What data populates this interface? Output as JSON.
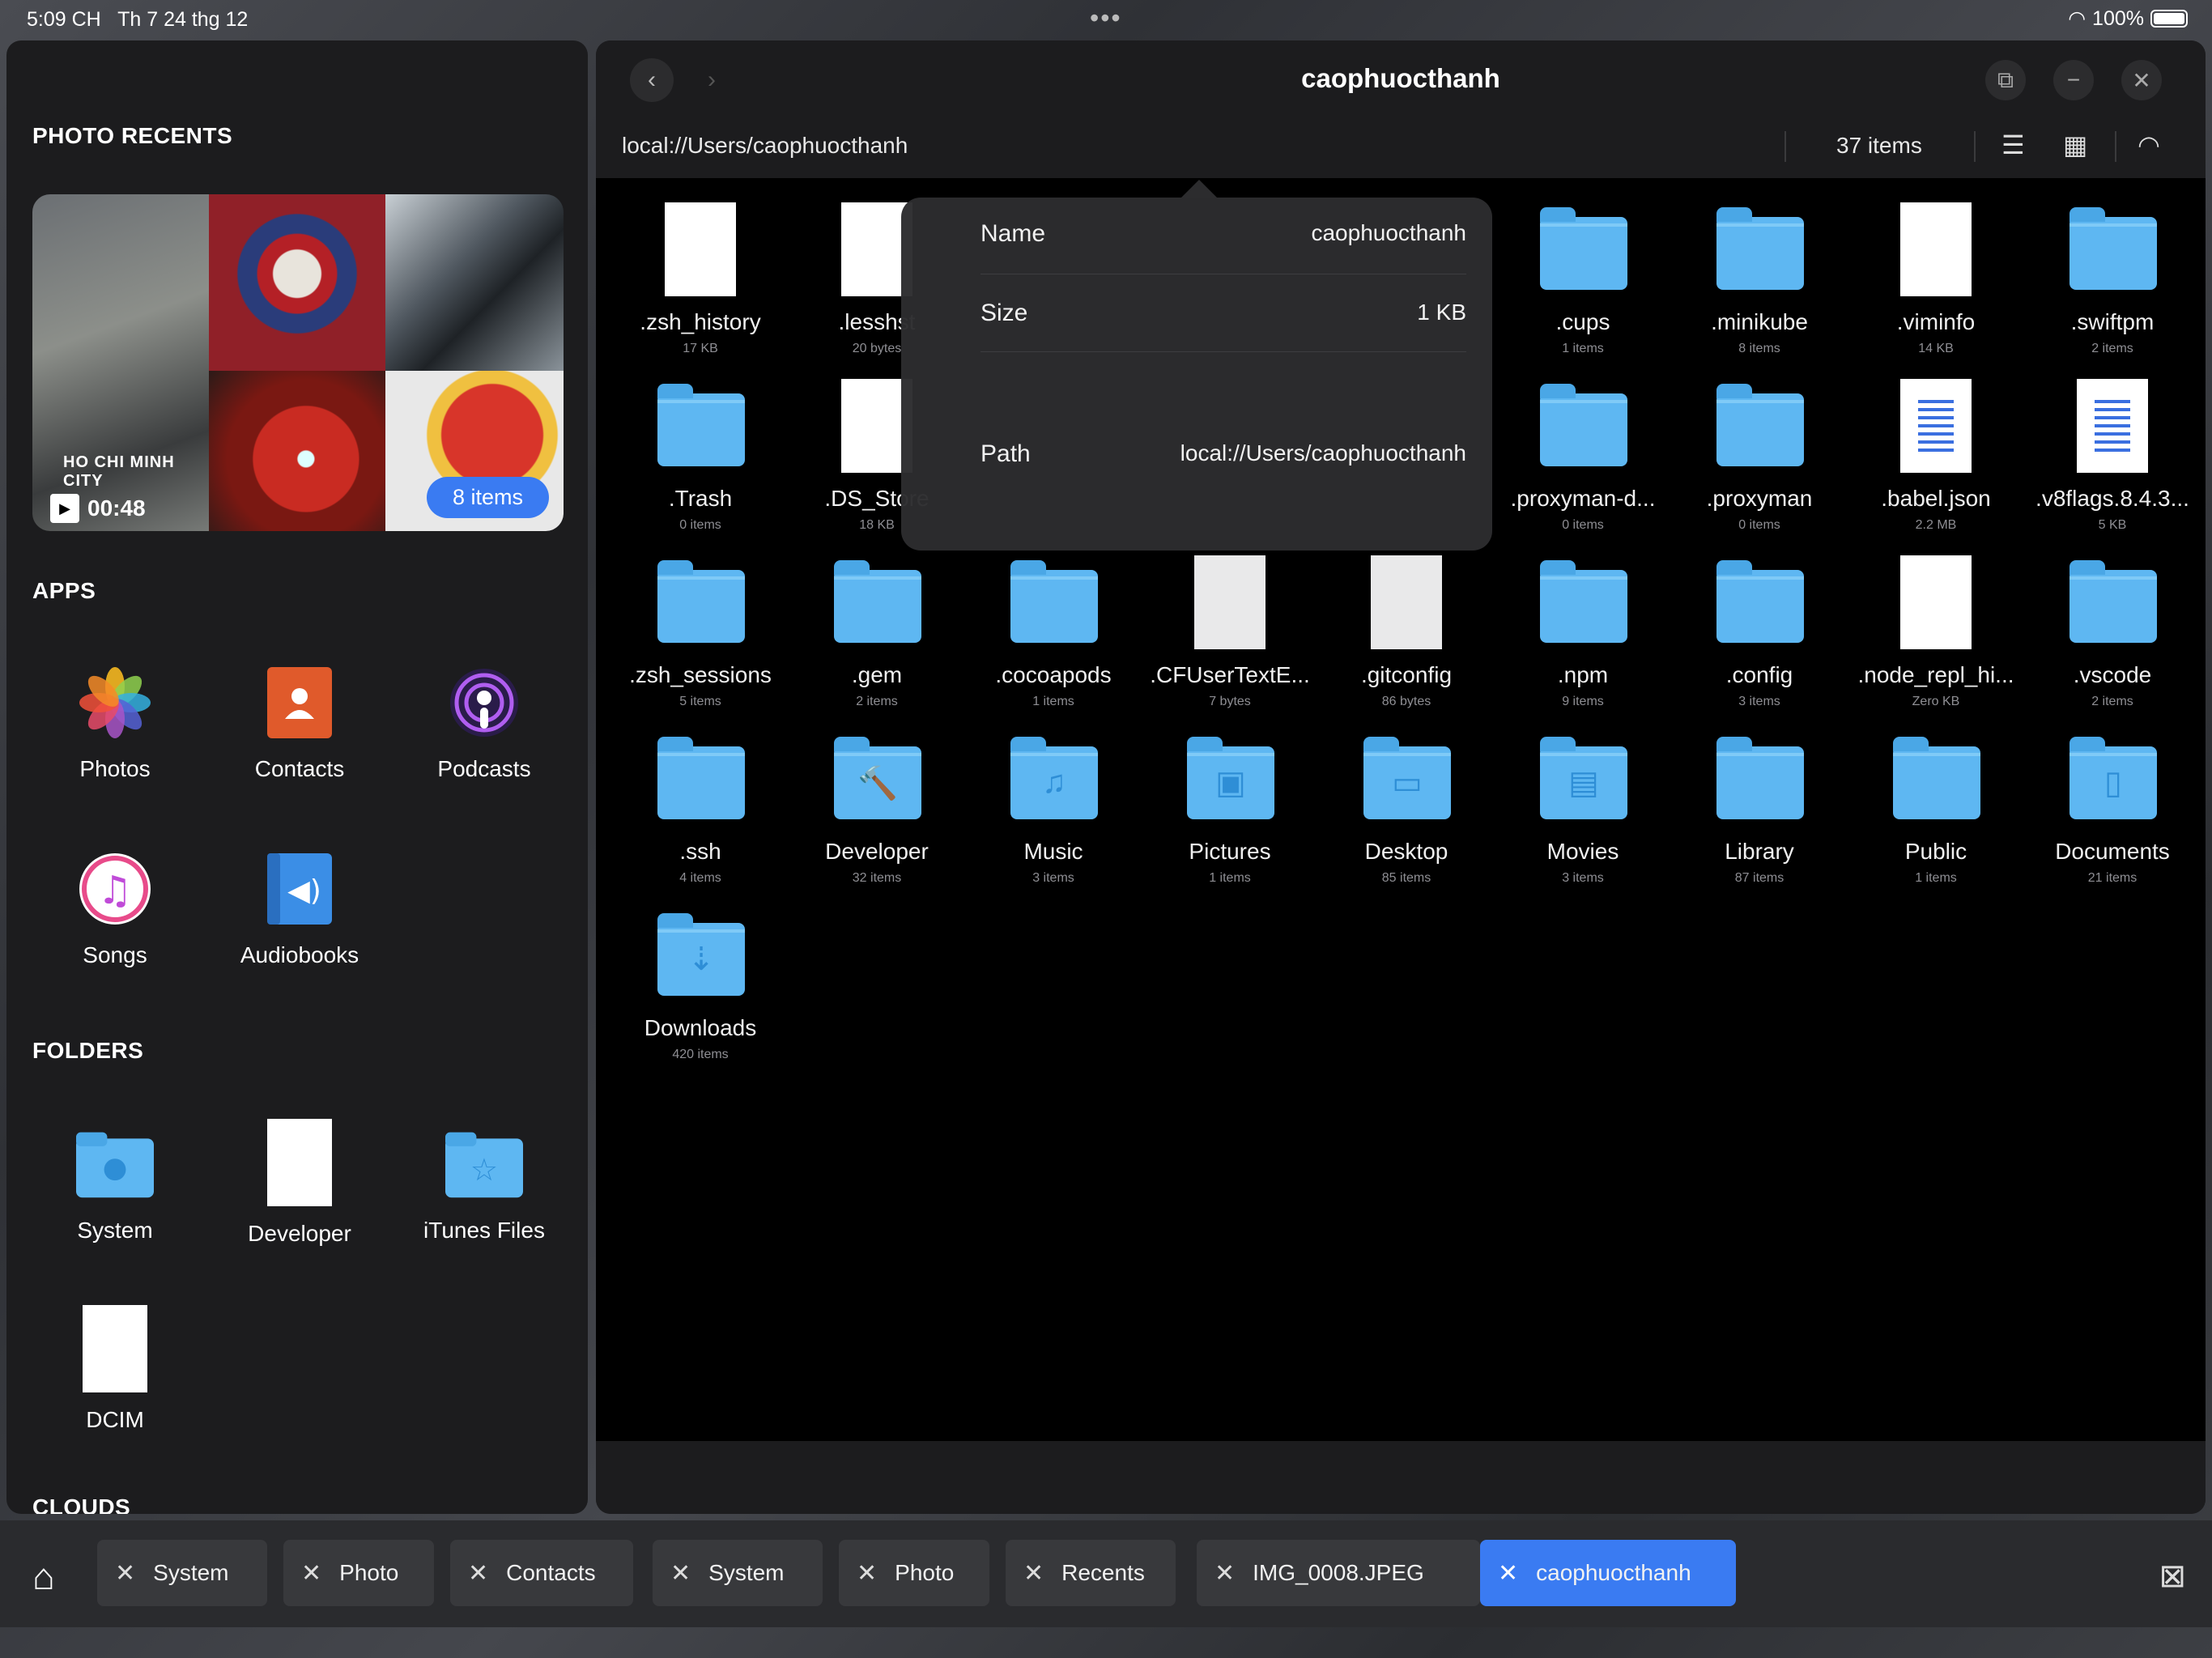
{
  "status": {
    "time": "5:09 CH",
    "date": "Th 7 24 thg 12",
    "battery": "100%"
  },
  "sidebar": {
    "photo_recents_title": "PHOTO RECENTS",
    "video_duration": "00:48",
    "video_caption": "HO CHI MINH CITY",
    "items_pill": "8 items",
    "apps_title": "APPS",
    "apps": [
      {
        "label": "Photos",
        "icon": "photos-icon"
      },
      {
        "label": "Contacts",
        "icon": "contacts-icon"
      },
      {
        "label": "Podcasts",
        "icon": "podcasts-icon"
      },
      {
        "label": "Songs",
        "icon": "songs-icon"
      },
      {
        "label": "Audiobooks",
        "icon": "audiobooks-icon"
      }
    ],
    "folders_title": "FOLDERS",
    "folders": [
      {
        "label": "System",
        "icon": "system-folder-icon"
      },
      {
        "label": "Developer",
        "icon": "document-icon"
      },
      {
        "label": "iTunes Files",
        "icon": "star-folder-icon"
      },
      {
        "label": "DCIM",
        "icon": "document-icon"
      }
    ],
    "clouds_title": "CLOUDS"
  },
  "window": {
    "title": "caophuocthanh",
    "path": "local://Users/caophuocthanh",
    "item_count": "37 items"
  },
  "files": [
    {
      "name": ".zsh_history",
      "meta": "17 KB",
      "kind": "doc"
    },
    {
      "name": ".lesshst",
      "meta": "20 bytes",
      "kind": "doc"
    },
    {
      "name": "",
      "meta": "",
      "kind": "hidden"
    },
    {
      "name": "",
      "meta": "",
      "kind": "hidden"
    },
    {
      "name": "",
      "meta": "",
      "kind": "hidden"
    },
    {
      "name": ".cups",
      "meta": "1 items",
      "kind": "folder"
    },
    {
      "name": ".minikube",
      "meta": "8 items",
      "kind": "folder"
    },
    {
      "name": ".viminfo",
      "meta": "14 KB",
      "kind": "doc"
    },
    {
      "name": ".swiftpm",
      "meta": "2 items",
      "kind": "folder"
    },
    {
      "name": ".Trash",
      "meta": "0 items",
      "kind": "folder"
    },
    {
      "name": ".DS_Store",
      "meta": "18 KB",
      "kind": "doc"
    },
    {
      "name": "",
      "meta": "",
      "kind": "hidden"
    },
    {
      "name": "",
      "meta": "",
      "kind": "hidden"
    },
    {
      "name": "",
      "meta": "",
      "kind": "hidden"
    },
    {
      "name": ".proxyman-d...",
      "meta": "0 items",
      "kind": "folder"
    },
    {
      "name": ".proxyman",
      "meta": "0 items",
      "kind": "folder"
    },
    {
      "name": ".babel.json",
      "meta": "2.2 MB",
      "kind": "txt"
    },
    {
      "name": ".v8flags.8.4.3...",
      "meta": "5 KB",
      "kind": "txt"
    },
    {
      "name": ".zsh_sessions",
      "meta": "5 items",
      "kind": "folder"
    },
    {
      "name": ".gem",
      "meta": "2 items",
      "kind": "folder"
    },
    {
      "name": ".cocoapods",
      "meta": "1 items",
      "kind": "folder"
    },
    {
      "name": ".CFUserTextE...",
      "meta": "7 bytes",
      "kind": "grey"
    },
    {
      "name": ".gitconfig",
      "meta": "86 bytes",
      "kind": "grey"
    },
    {
      "name": ".npm",
      "meta": "9 items",
      "kind": "folder"
    },
    {
      "name": ".config",
      "meta": "3 items",
      "kind": "folder"
    },
    {
      "name": ".node_repl_hi...",
      "meta": "Zero KB",
      "kind": "doc"
    },
    {
      "name": ".vscode",
      "meta": "2 items",
      "kind": "folder"
    },
    {
      "name": ".ssh",
      "meta": "4 items",
      "kind": "folder"
    },
    {
      "name": "Developer",
      "meta": "32 items",
      "kind": "folder",
      "glyph": "🔨"
    },
    {
      "name": "Music",
      "meta": "3 items",
      "kind": "folder",
      "glyph": "♫"
    },
    {
      "name": "Pictures",
      "meta": "1 items",
      "kind": "folder",
      "glyph": "▣"
    },
    {
      "name": "Desktop",
      "meta": "85 items",
      "kind": "folder",
      "glyph": "▭"
    },
    {
      "name": "Movies",
      "meta": "3 items",
      "kind": "folder",
      "glyph": "▤"
    },
    {
      "name": "Library",
      "meta": "87 items",
      "kind": "folder"
    },
    {
      "name": "Public",
      "meta": "1 items",
      "kind": "folder"
    },
    {
      "name": "Documents",
      "meta": "21 items",
      "kind": "folder",
      "glyph": "▯"
    },
    {
      "name": "Downloads",
      "meta": "420 items",
      "kind": "folder",
      "glyph": "⇣"
    }
  ],
  "popover": {
    "name_label": "Name",
    "name_value": "caophuocthanh",
    "size_label": "Size",
    "size_value": "1 KB",
    "path_label": "Path",
    "path_value": "local://Users/caophuocthanh"
  },
  "tabs": [
    {
      "label": "System",
      "active": false
    },
    {
      "label": "Photo",
      "active": false
    },
    {
      "label": "Contacts",
      "active": false
    },
    {
      "label": "System",
      "active": false
    },
    {
      "label": "Photo",
      "active": false
    },
    {
      "label": "Recents",
      "active": false
    },
    {
      "label": "IMG_0008.JPEG",
      "active": false
    },
    {
      "label": "caophuocthanh",
      "active": true
    }
  ],
  "colors": {
    "accent": "#3a7bf2",
    "folder": "#5eb7f2",
    "panel": "#1c1c1e"
  }
}
